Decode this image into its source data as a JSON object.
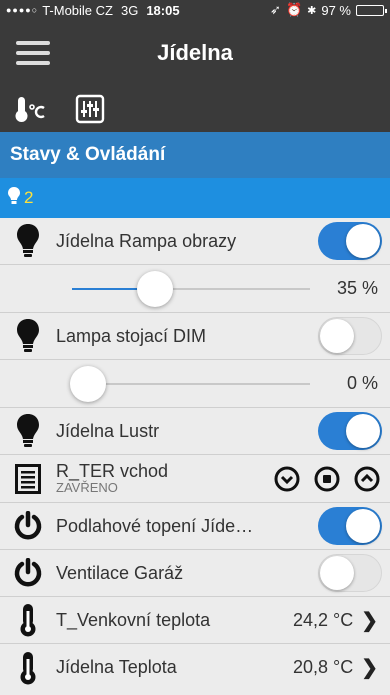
{
  "status": {
    "signal": "●●●●○",
    "carrier": "T-Mobile CZ",
    "network": "3G",
    "time": "18:05",
    "battery": "97 %",
    "battery_level": 0.97
  },
  "header": {
    "title": "Jídelna"
  },
  "toolbar": {
    "icons": [
      "thermometer-celsius-icon",
      "sliders-icon"
    ]
  },
  "section": {
    "title": "Stavy & Ovládání",
    "lights_on_count": "2"
  },
  "rows": {
    "r1": {
      "label": "Jídelna Rampa obrazy",
      "on": true
    },
    "s1": {
      "value": "35 %",
      "level": 0.35
    },
    "r2": {
      "label": "Lampa stojací DIM",
      "on": false
    },
    "s2": {
      "value": "0 %",
      "level": 0.0
    },
    "r3": {
      "label": "Jídelna Lustr",
      "on": true
    },
    "blind": {
      "label": "R_TER vchod",
      "state": "ZAVŘENO"
    },
    "r4": {
      "label": "Podlahové topení Jíde…",
      "on": true
    },
    "r5": {
      "label": "Ventilace Garáž",
      "on": false
    },
    "t1": {
      "label": "T_Venkovní teplota",
      "value": "24,2 °C"
    },
    "t2": {
      "label": "Jídelna Teplota",
      "value": "20,8 °C"
    }
  },
  "colors": {
    "accent": "#2a7fd4",
    "section": "#2f7fc1",
    "subhead": "#1e8fe0",
    "header": "#3a3a3a"
  }
}
